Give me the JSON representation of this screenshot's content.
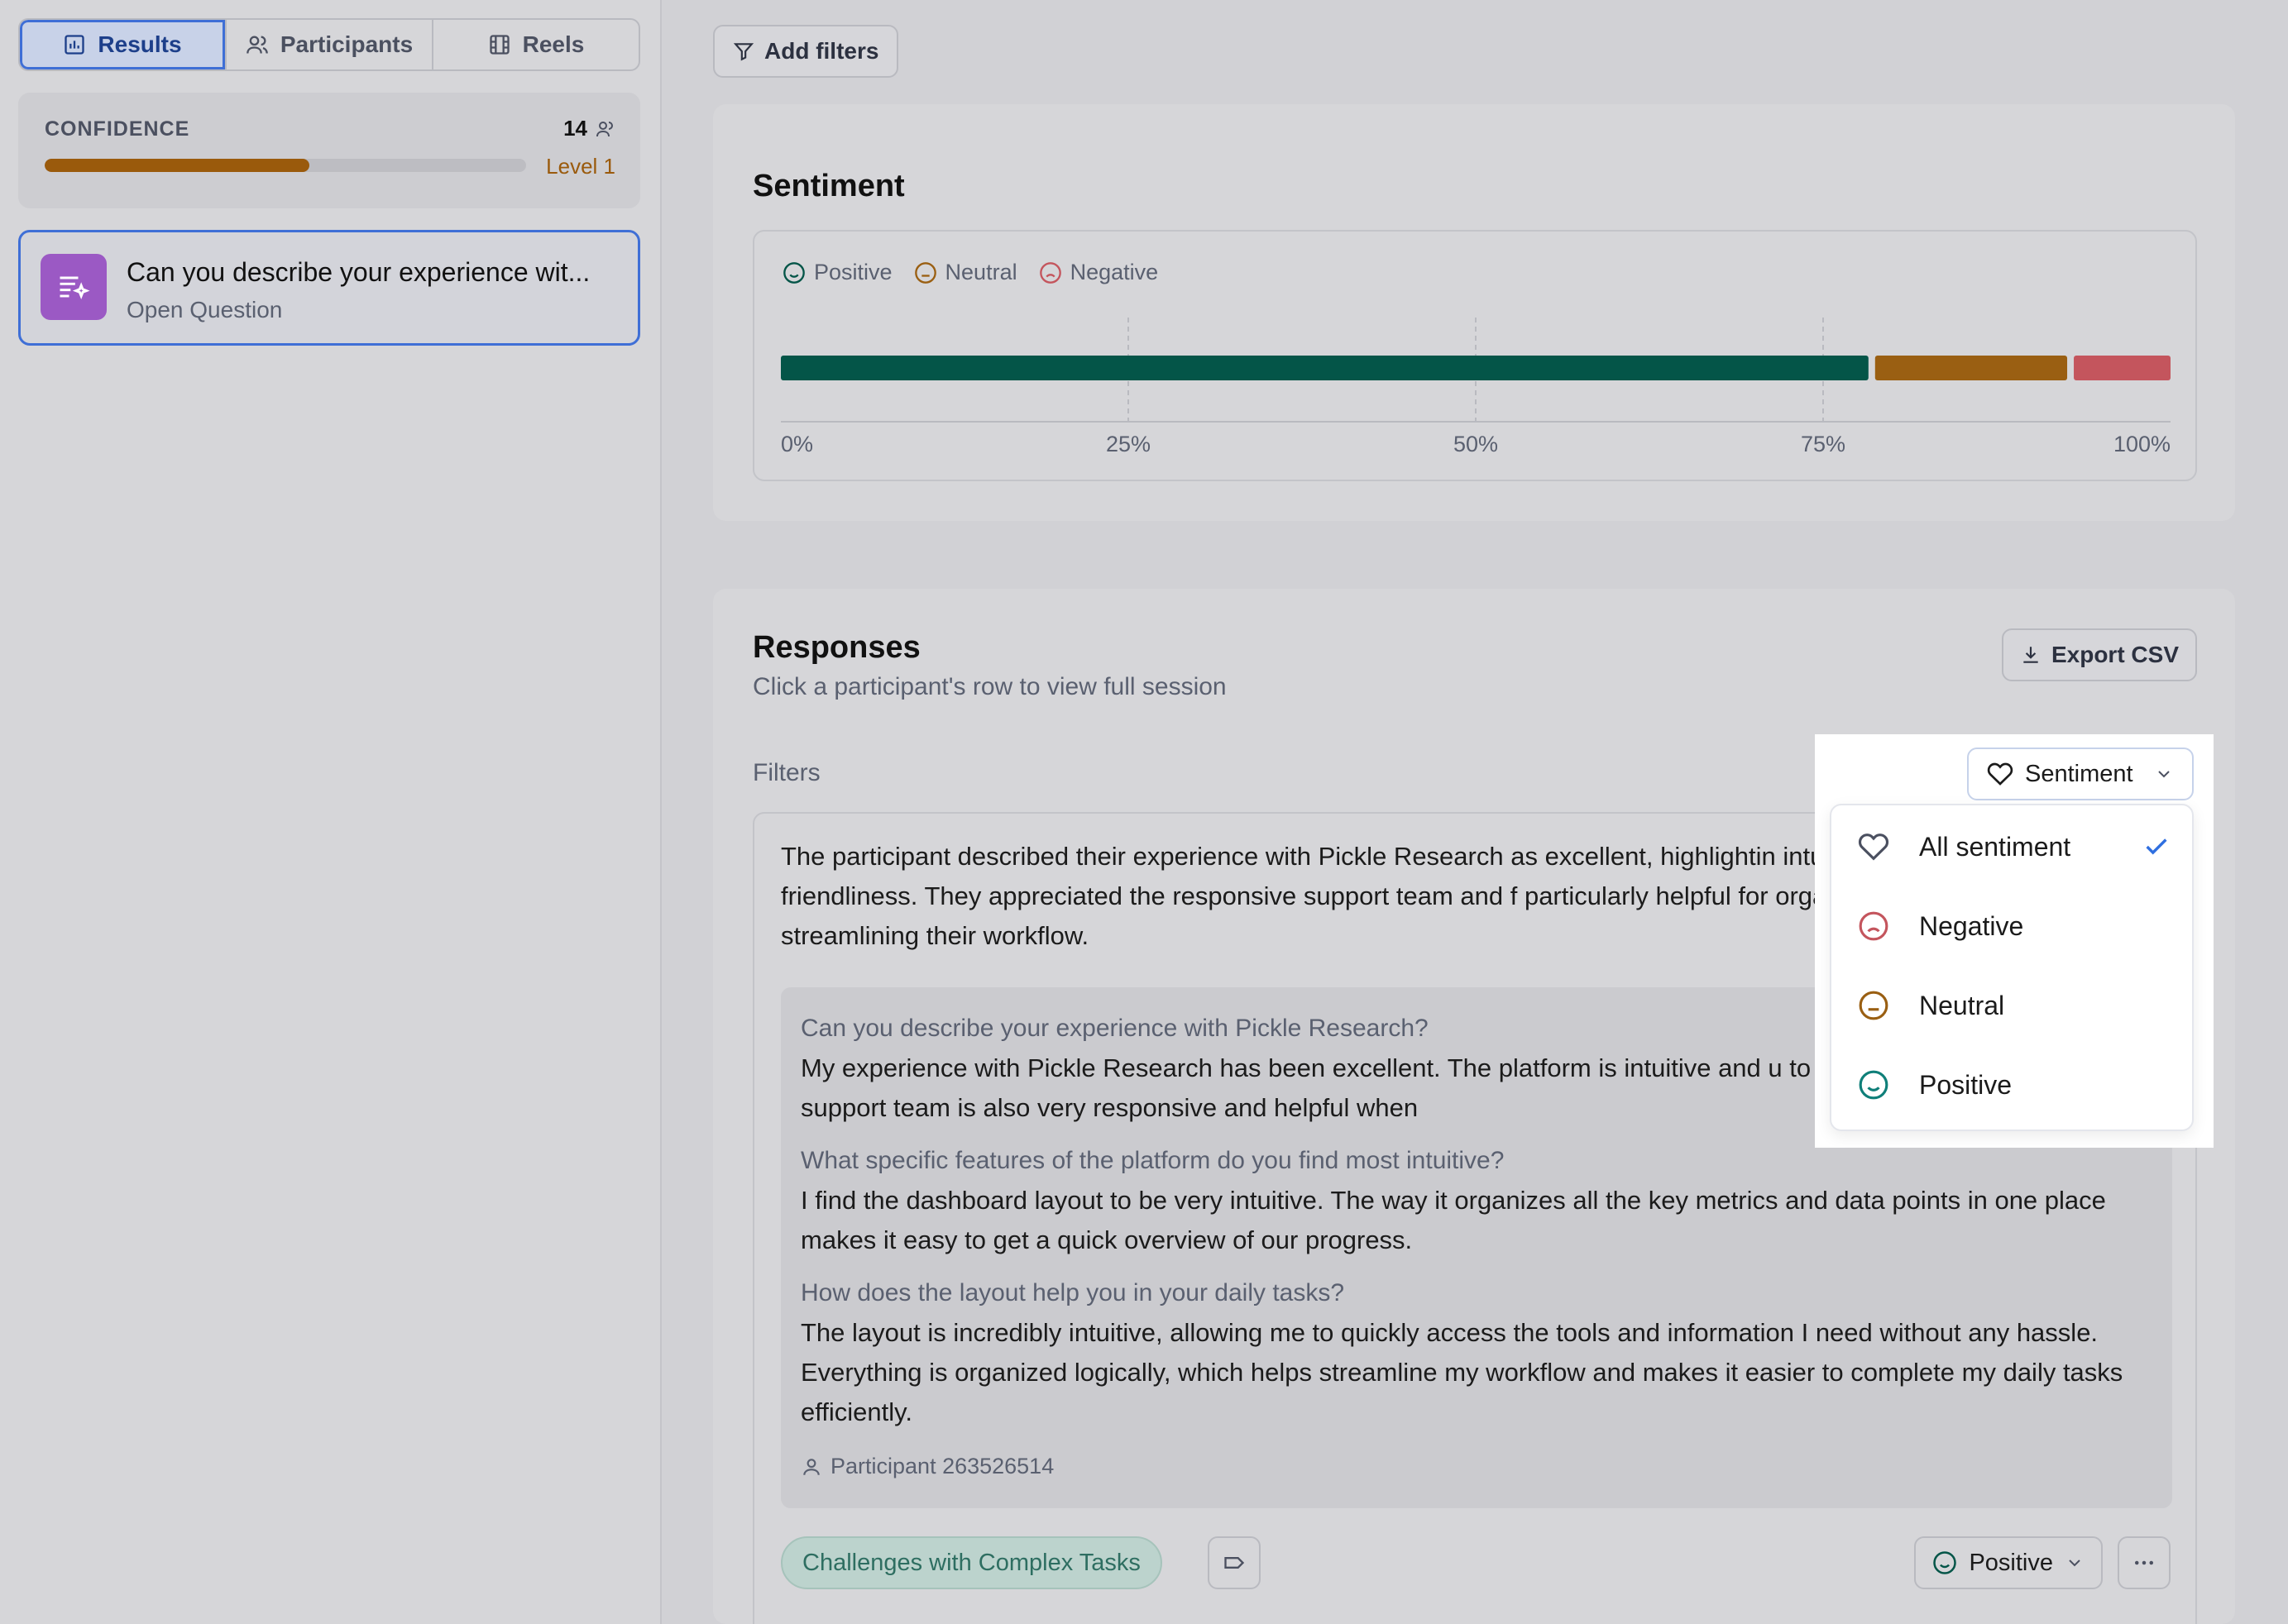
{
  "sidebar": {
    "tabs": [
      {
        "label": "Results",
        "icon": "bar-chart-icon",
        "active": true
      },
      {
        "label": "Participants",
        "icon": "users-icon",
        "active": false
      },
      {
        "label": "Reels",
        "icon": "film-icon",
        "active": false
      }
    ],
    "confidence": {
      "label": "CONFIDENCE",
      "count": "14",
      "level": "Level 1",
      "progress_fraction": 0.55
    },
    "question": {
      "title": "Can you describe your experience wit...",
      "type": "Open Question"
    }
  },
  "toolbar": {
    "add_filters": "Add filters"
  },
  "sentiment": {
    "title": "Sentiment",
    "legend": [
      {
        "label": "Positive",
        "icon": "smile-icon",
        "color": "#045548"
      },
      {
        "label": "Neutral",
        "icon": "neutral-face-icon",
        "color": "#9a5f12"
      },
      {
        "label": "Negative",
        "icon": "frown-icon",
        "color": "#c4555d"
      }
    ]
  },
  "chart_data": {
    "type": "bar",
    "orientation": "horizontal-stacked",
    "series": [
      {
        "name": "Positive",
        "values": [
          78.5
        ]
      },
      {
        "name": "Neutral",
        "values": [
          14.3
        ]
      },
      {
        "name": "Negative",
        "values": [
          7.2
        ]
      }
    ],
    "xlim": [
      0,
      100
    ],
    "xticks": [
      "0%",
      "25%",
      "50%",
      "75%",
      "100%"
    ],
    "grid": true,
    "legend_position": "top-left",
    "colors": {
      "Positive": "#045548",
      "Neutral": "#9a5f12",
      "Negative": "#c4555d"
    }
  },
  "responses": {
    "title": "Responses",
    "subtitle": "Click a participant's row to view full session",
    "export_label": "Export CSV",
    "filters_label": "Filters",
    "summary": "The participant described their experience with Pickle Research as excellent, highlightin intuitiveness and user-friendliness. They appreciated the responsive support team and f particularly helpful for organizing key metrics and streamlining their workflow.",
    "qa": [
      {
        "q": "Can you describe your experience with Pickle Research?",
        "a": "My experience with Pickle Research has been excellent. The platform is intuitive and u to gather and analyze data. The support team is also very responsive and helpful when"
      },
      {
        "q": "What specific features of the platform do you find most intuitive?",
        "a": "I find the dashboard layout to be very intuitive. The way it organizes all the key metrics and data points in one place makes it easy to get a quick overview of our progress."
      },
      {
        "q": "How does the layout help you in your daily tasks?",
        "a": "The layout is incredibly intuitive, allowing me to quickly access the tools and information I need without any hassle. Everything is organized logically, which helps streamline my workflow and makes it easier to complete my daily tasks efficiently."
      }
    ],
    "participant": "Participant 263526514",
    "tag": "Challenges with Complex Tasks",
    "sentiment_value": "Positive"
  },
  "dropdown": {
    "trigger_label": "Sentiment",
    "options": [
      {
        "label": "All sentiment",
        "icon": "heart-icon",
        "selected": true
      },
      {
        "label": "Negative",
        "icon": "frown-icon",
        "selected": false
      },
      {
        "label": "Neutral",
        "icon": "neutral-face-icon",
        "selected": false
      },
      {
        "label": "Positive",
        "icon": "smile-icon",
        "selected": false
      }
    ]
  }
}
